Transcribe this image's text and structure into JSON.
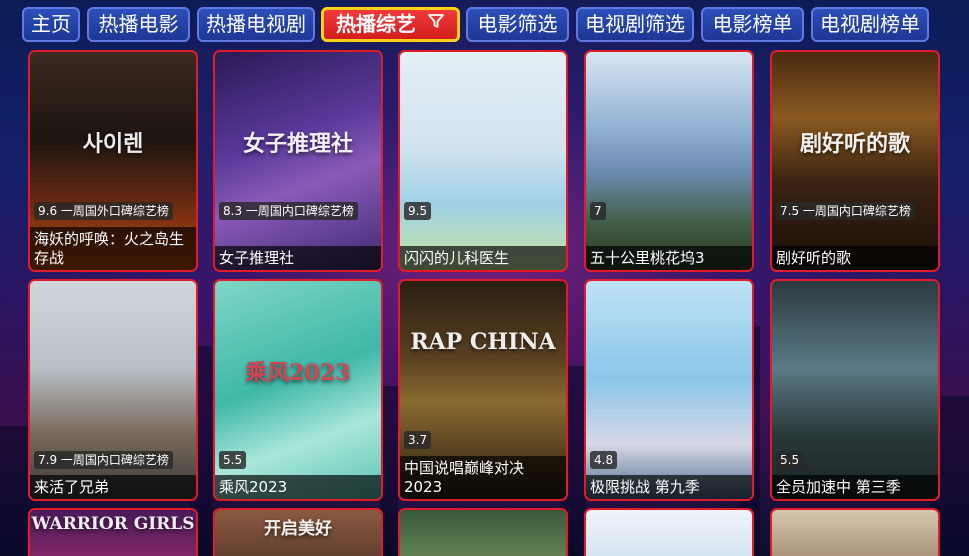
{
  "nav": {
    "tabs": [
      {
        "label": "主页"
      },
      {
        "label": "热播电影"
      },
      {
        "label": "热播电视剧"
      },
      {
        "label": "热播综艺"
      },
      {
        "label": "电影筛选"
      },
      {
        "label": "电视剧筛选"
      },
      {
        "label": "电影榜单"
      },
      {
        "label": "电视剧榜单"
      }
    ],
    "active_tab": "热播综艺",
    "active_icon": "filter-icon"
  },
  "colors": {
    "tab_bg": "#2c4fb8",
    "tab_border": "#5f79e6",
    "active_tab_bg": "#e32a2a",
    "active_tab_border": "#ffd21a",
    "card_border": "#e01c2a"
  },
  "cards": [
    {
      "badge": "9.6 一周国外口碑综艺榜",
      "title": "海妖的呼唤：火之岛生存战",
      "poster_text": "사이렌"
    },
    {
      "badge": "8.3 一周国内口碑综艺榜",
      "title": "女子推理社",
      "poster_text": "女子推理社"
    },
    {
      "badge": "9.5",
      "title": "闪闪的儿科医生",
      "poster_text": ""
    },
    {
      "badge": "7",
      "title": "五十公里桃花坞3",
      "poster_text": ""
    },
    {
      "badge": "7.5 一周国内口碑综艺榜",
      "title": "剧好听的歌",
      "poster_text": "剧好听的歌"
    },
    {
      "badge": "7.9 一周国内口碑综艺榜",
      "title": "来活了兄弟",
      "poster_text": ""
    },
    {
      "badge": "5.5",
      "title": "乘风2023",
      "poster_text": "乘风2023"
    },
    {
      "badge": "3.7",
      "title": "中国说唱巅峰对决2023",
      "poster_text": "RAP CHINA"
    },
    {
      "badge": "4.8",
      "title": "极限挑战 第九季",
      "poster_text": ""
    },
    {
      "badge": "5.5",
      "title": "全员加速中 第三季",
      "poster_text": ""
    },
    {
      "badge": "",
      "title": "",
      "poster_text": "WARRIOR GIRLS"
    },
    {
      "badge": "",
      "title": "",
      "poster_text": "开启美好"
    },
    {
      "badge": "",
      "title": "",
      "poster_text": ""
    },
    {
      "badge": "",
      "title": "",
      "poster_text": ""
    },
    {
      "badge": "",
      "title": "",
      "poster_text": ""
    }
  ]
}
